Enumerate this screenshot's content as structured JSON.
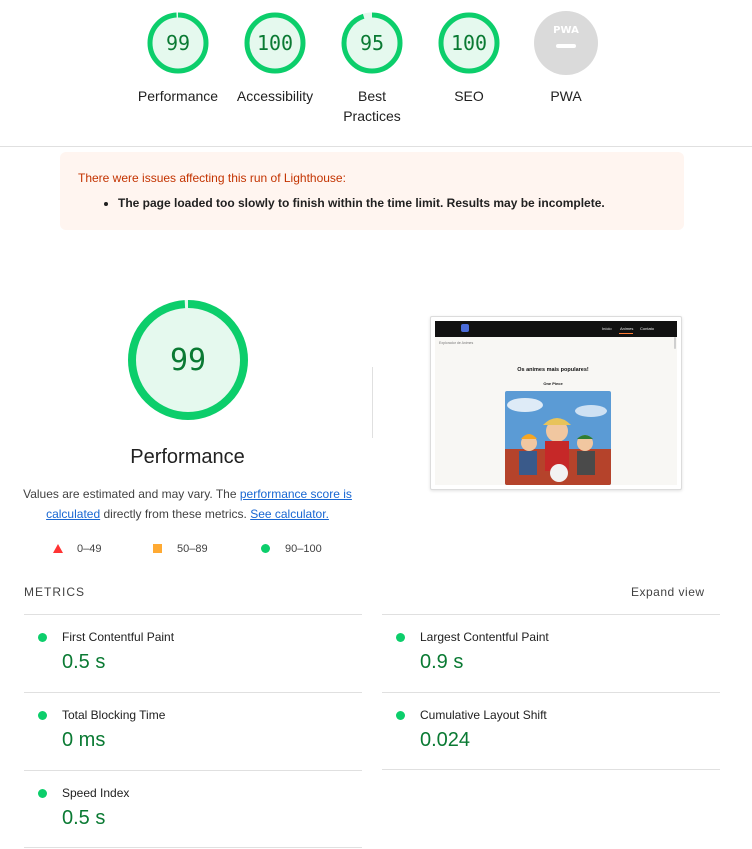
{
  "scores": [
    {
      "label": "Performance",
      "value": "99",
      "fraction": 0.99
    },
    {
      "label": "Accessibility",
      "value": "100",
      "fraction": 1.0
    },
    {
      "label": "Best Practices",
      "value": "95",
      "fraction": 0.95
    },
    {
      "label": "SEO",
      "value": "100",
      "fraction": 1.0
    },
    {
      "label": "PWA",
      "value": "",
      "fraction": 0
    }
  ],
  "pwa_badge_text": "PWA",
  "colors": {
    "pass": "#0cce6b",
    "pass_text": "#0a7a33",
    "pass_bg": "#e5f9ee",
    "average": "#ffaa33",
    "fail": "#ff3333",
    "warning_text": "#c33300"
  },
  "warning": {
    "title": "There were issues affecting this run of Lighthouse:",
    "items": [
      "The page loaded too slowly to finish within the time limit. Results may be incomplete."
    ]
  },
  "performance": {
    "score": "99",
    "fraction": 0.99,
    "title": "Performance",
    "desc_prefix": "Values are estimated and may vary. The ",
    "desc_link": "performance score is calculated",
    "desc_middle": " directly from these metrics. ",
    "desc_calc": "See calculator."
  },
  "legend": [
    {
      "icon": "fail-triangle-icon",
      "text": "0–49"
    },
    {
      "icon": "average-square-icon",
      "text": "50–89"
    },
    {
      "icon": "pass-circle-icon",
      "text": "90–100"
    }
  ],
  "thumbnail": {
    "nav": [
      "Início",
      "Animes",
      "Contato"
    ],
    "crumb": "Explorador de Animes",
    "heading": "Os animes mais populares!",
    "subheading": "One Piece"
  },
  "metrics_header": "METRICS",
  "expand_label": "Expand view",
  "metrics": [
    {
      "title": "First Contentful Paint",
      "value": "0.5 s"
    },
    {
      "title": "Largest Contentful Paint",
      "value": "0.9 s"
    },
    {
      "title": "Total Blocking Time",
      "value": "0 ms"
    },
    {
      "title": "Cumulative Layout Shift",
      "value": "0.024"
    },
    {
      "title": "Speed Index",
      "value": "0.5 s"
    }
  ]
}
